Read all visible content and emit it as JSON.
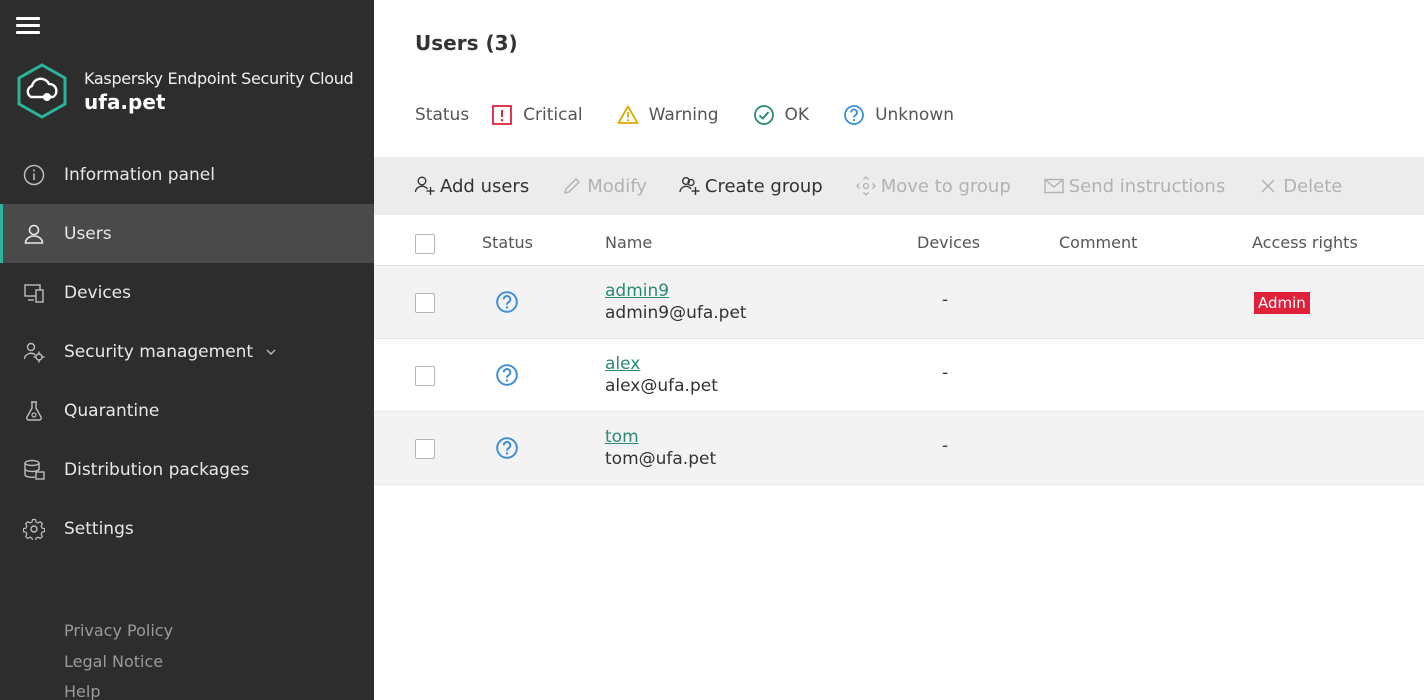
{
  "sidebar": {
    "brand": {
      "product": "Kaspersky Endpoint Security Cloud",
      "org": "ufa.pet"
    },
    "items": [
      {
        "label": "Information panel",
        "icon": "info-icon"
      },
      {
        "label": "Users",
        "icon": "user-icon",
        "active": true
      },
      {
        "label": "Devices",
        "icon": "devices-icon"
      },
      {
        "label": "Security management",
        "icon": "security-management-icon",
        "expandable": true
      },
      {
        "label": "Quarantine",
        "icon": "quarantine-icon"
      },
      {
        "label": "Distribution packages",
        "icon": "distribution-packages-icon"
      },
      {
        "label": "Settings",
        "icon": "gear-icon"
      }
    ],
    "footer": [
      "Privacy Policy",
      "Legal Notice",
      "Help"
    ]
  },
  "main": {
    "title": "Users (3)",
    "status_legend": {
      "label": "Status",
      "items": [
        "Critical",
        "Warning",
        "OK",
        "Unknown"
      ]
    },
    "toolbar": {
      "add_users": "Add users",
      "modify": "Modify",
      "create_group": "Create group",
      "move_to_group": "Move to group",
      "send_instructions": "Send instructions",
      "delete": "Delete"
    },
    "table": {
      "headers": {
        "status": "Status",
        "name": "Name",
        "devices": "Devices",
        "comment": "Comment",
        "access_rights": "Access rights"
      },
      "rows": [
        {
          "name": "admin9",
          "email": "admin9@ufa.pet",
          "devices": "-",
          "access": "Admin"
        },
        {
          "name": "alex",
          "email": "alex@ufa.pet",
          "devices": "-",
          "access": ""
        },
        {
          "name": "tom",
          "email": "tom@ufa.pet",
          "devices": "-",
          "access": ""
        }
      ]
    }
  },
  "colors": {
    "sidebar_bg": "#2d2d2d",
    "accent": "#2bb39c",
    "link": "#2a8a73",
    "critical": "#e0213a",
    "warning": "#e0a800",
    "ok": "#2a8a73",
    "unknown": "#3d8ed6",
    "admin_badge": "#e0213a"
  }
}
